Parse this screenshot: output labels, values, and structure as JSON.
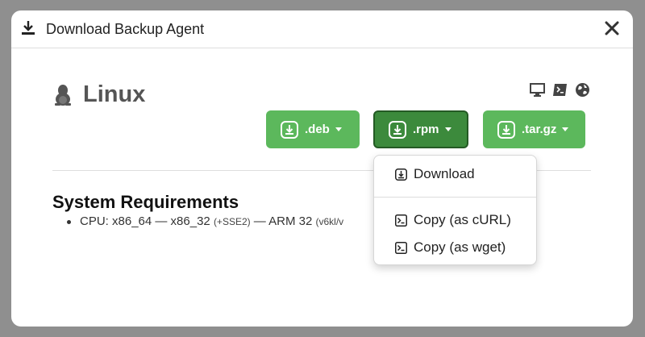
{
  "modal": {
    "title": "Download Backup Agent",
    "icons": {
      "header": "download-icon",
      "close": "close-icon"
    }
  },
  "os": {
    "name": "Linux",
    "icon": "penguin-icon"
  },
  "platform_icons": [
    "monitor-icon",
    "terminal-icon",
    "globe-icon"
  ],
  "buttons": [
    {
      "label": ".deb",
      "icon": "download-box-icon"
    },
    {
      "label": ".rpm",
      "icon": "download-box-icon",
      "active": true
    },
    {
      "label": ".tar.gz",
      "icon": "download-box-icon"
    }
  ],
  "requirements": {
    "title": "System Requirements",
    "cpu_prefix": "CPU: x86_64 — x86_32 ",
    "cpu_note1": "(+SSE2)",
    "cpu_mid": " — ARM 32 ",
    "cpu_note2": "(v6kl/v"
  },
  "dropdown": {
    "items": [
      {
        "label": "Download",
        "icon": "download-box-icon"
      },
      {
        "label": "Copy (as cURL)",
        "icon": "terminal-box-icon"
      },
      {
        "label": "Copy (as wget)",
        "icon": "terminal-box-icon"
      }
    ]
  },
  "colors": {
    "button_green": "#5cb85c",
    "button_active": "#3c8a3c",
    "overlay": "#8f8f8f"
  }
}
